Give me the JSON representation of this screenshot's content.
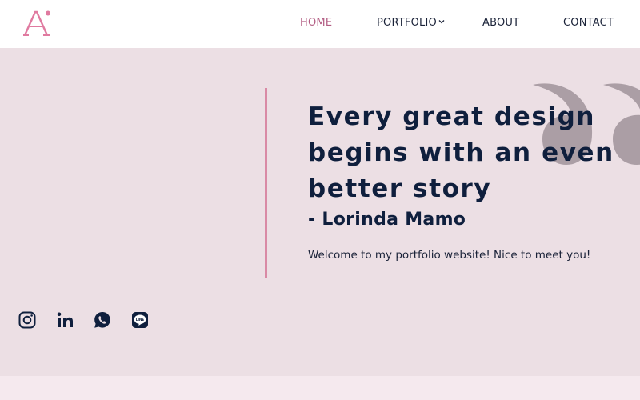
{
  "brand": {
    "logo_letter": "A",
    "logo_color": "#e07aa0"
  },
  "nav": {
    "items": [
      {
        "label": "HOME",
        "active": true
      },
      {
        "label": "PORTFOLIO",
        "has_dropdown": true
      },
      {
        "label": "ABOUT"
      },
      {
        "label": "CONTACT"
      }
    ]
  },
  "hero": {
    "headline_lines": [
      "Every great design",
      "begins with an even",
      "better story"
    ],
    "author": "- Lorinda Mamo",
    "welcome": "Welcome to my portfolio website! Nice to meet you!",
    "quote_icon": "double-quote-icon",
    "colors": {
      "background": "#ecdfe4",
      "accent": "#d98aa5",
      "text": "#0f1f3d",
      "quote_mark": "#ab9ea5"
    }
  },
  "socials": [
    {
      "name": "instagram-icon"
    },
    {
      "name": "linkedin-icon"
    },
    {
      "name": "whatsapp-icon"
    },
    {
      "name": "line-icon"
    }
  ]
}
